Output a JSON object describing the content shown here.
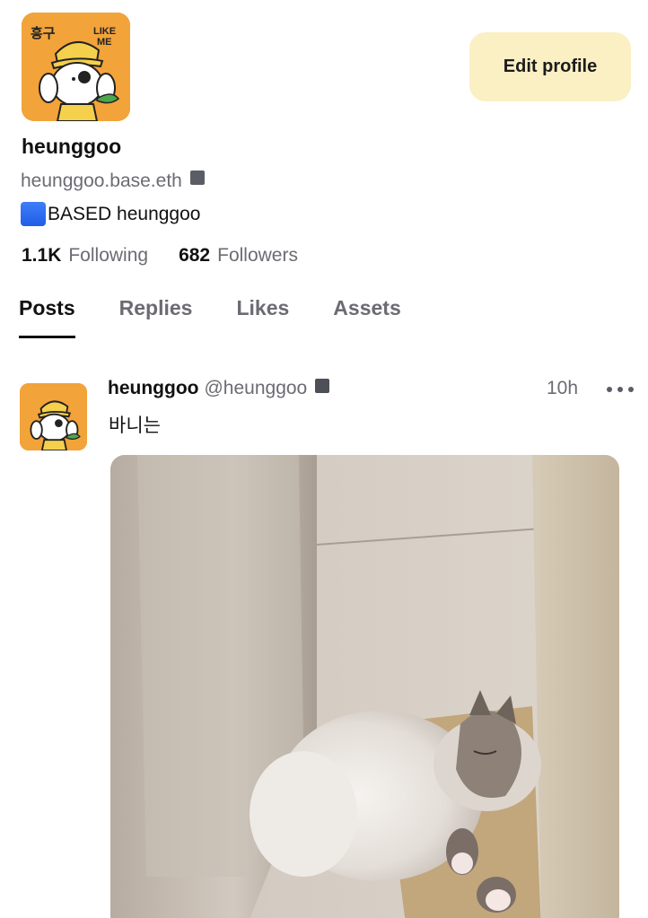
{
  "profile": {
    "display_name": "heunggoo",
    "handle": "heunggoo.base.eth",
    "bio_text": "BASED heunggoo",
    "edit_button_label": "Edit profile",
    "avatar_text_top": "흥구",
    "avatar_text_like": "LIKE",
    "avatar_text_me": "ME"
  },
  "stats": {
    "following_count": "1.1K",
    "following_label": "Following",
    "followers_count": "682",
    "followers_label": "Followers"
  },
  "tabs": [
    {
      "label": "Posts",
      "active": true
    },
    {
      "label": "Replies",
      "active": false
    },
    {
      "label": "Likes",
      "active": false
    },
    {
      "label": "Assets",
      "active": false
    }
  ],
  "post": {
    "author_name": "heunggoo",
    "author_handle": "@heunggoo",
    "time": "10h",
    "text": "바니는",
    "image_subject": "fluffy cat sleeping in corner of cat tower"
  },
  "colors": {
    "avatar_bg": "#F2A33A",
    "edit_button_bg": "#FBEFC4",
    "secondary_text": "#6b6b73",
    "badge_blue": "#2f6ff2"
  },
  "icons": {
    "verified_badge": "square-badge-icon",
    "more": "more-horizontal-icon",
    "bio_badge": "blue-square-icon"
  }
}
